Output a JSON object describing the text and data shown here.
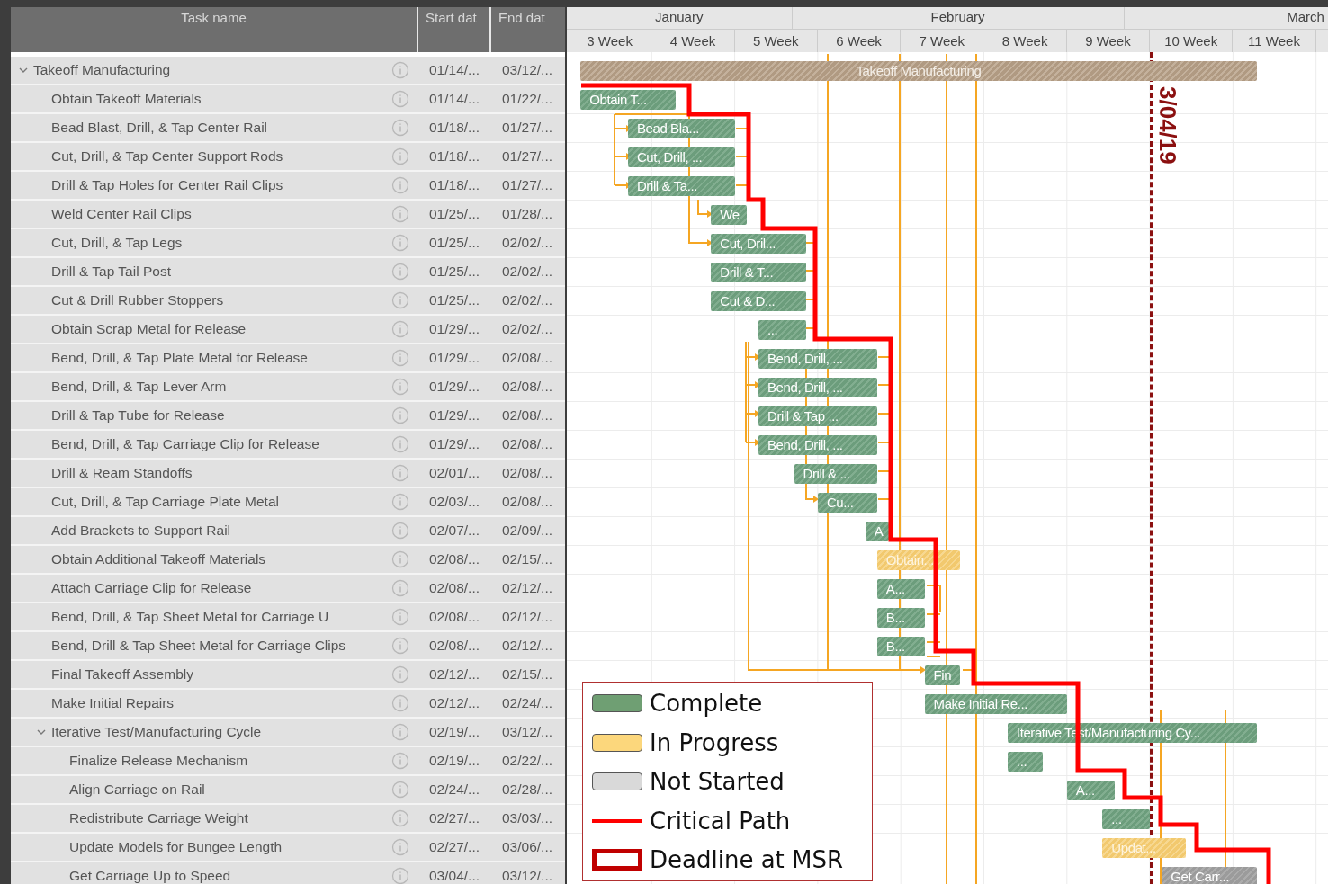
{
  "columns": [
    "Task name",
    "Start dat",
    "End dat"
  ],
  "timeline": {
    "months": [
      "January",
      "February",
      "March"
    ],
    "weeks": [
      "3 Week",
      "4 Week",
      "5 Week",
      "6 Week",
      "7 Week",
      "8 Week",
      "9 Week",
      "10 Week",
      "11 Week"
    ]
  },
  "tasks": [
    {
      "name": "Takeoff Manufacturing",
      "start": "01/14/...",
      "end": "03/12/...",
      "kind": "summary",
      "bar_label": "Takeoff Manufacturing",
      "expanded": true,
      "children": [
        {
          "name": "Obtain Takeoff Materials",
          "start": "01/14/...",
          "end": "01/22/...",
          "kind": "complete",
          "bar_label": "Obtain T..."
        },
        {
          "name": "Bead Blast, Drill, & Tap Center Rail",
          "start": "01/18/...",
          "end": "01/27/...",
          "kind": "complete",
          "bar_label": "Bead Bla..."
        },
        {
          "name": "Cut, Drill, & Tap Center Support Rods",
          "start": "01/18/...",
          "end": "01/27/...",
          "kind": "complete",
          "bar_label": "Cut, Drill, ..."
        },
        {
          "name": "Drill & Tap Holes for Center Rail Clips",
          "start": "01/18/...",
          "end": "01/27/...",
          "kind": "complete",
          "bar_label": "Drill & Ta..."
        },
        {
          "name": "Weld Center Rail Clips",
          "start": "01/25/...",
          "end": "01/28/...",
          "kind": "complete",
          "bar_label": "We"
        },
        {
          "name": "Cut, Drill, & Tap Legs",
          "start": "01/25/...",
          "end": "02/02/...",
          "kind": "complete",
          "bar_label": "Cut, Dril..."
        },
        {
          "name": "Drill & Tap Tail Post",
          "start": "01/25/...",
          "end": "02/02/...",
          "kind": "complete",
          "bar_label": "Drill & T..."
        },
        {
          "name": "Cut & Drill Rubber Stoppers",
          "start": "01/25/...",
          "end": "02/02/...",
          "kind": "complete",
          "bar_label": "Cut & D..."
        },
        {
          "name": "Obtain Scrap Metal for Release",
          "start": "01/29/...",
          "end": "02/02/...",
          "kind": "complete",
          "bar_label": "..."
        },
        {
          "name": "Bend, Drill, & Tap Plate Metal for Release",
          "start": "01/29/...",
          "end": "02/08/...",
          "kind": "complete",
          "bar_label": "Bend, Drill, ..."
        },
        {
          "name": "Bend, Drill, & Tap Lever Arm",
          "start": "01/29/...",
          "end": "02/08/...",
          "kind": "complete",
          "bar_label": "Bend, Drill, ..."
        },
        {
          "name": "Drill & Tap Tube for Release",
          "start": "01/29/...",
          "end": "02/08/...",
          "kind": "complete",
          "bar_label": "Drill & Tap ..."
        },
        {
          "name": "Bend, Drill, & Tap Carriage Clip for Release",
          "start": "01/29/...",
          "end": "02/08/...",
          "kind": "complete",
          "bar_label": "Bend, Drill, ..."
        },
        {
          "name": "Drill & Ream Standoffs",
          "start": "02/01/...",
          "end": "02/08/...",
          "kind": "complete",
          "bar_label": "Drill & ..."
        },
        {
          "name": "Cut, Drill, & Tap Carriage Plate Metal",
          "start": "02/03/...",
          "end": "02/08/...",
          "kind": "complete",
          "bar_label": "Cu..."
        },
        {
          "name": "Add Brackets to Support Rail",
          "start": "02/07/...",
          "end": "02/09/...",
          "kind": "complete",
          "bar_label": "A"
        },
        {
          "name": "Obtain Additional Takeoff Materials",
          "start": "02/08/...",
          "end": "02/15/...",
          "kind": "in_progress",
          "bar_label": "Obtain..."
        },
        {
          "name": "Attach Carriage Clip for Release",
          "start": "02/08/...",
          "end": "02/12/...",
          "kind": "complete",
          "bar_label": "A..."
        },
        {
          "name": "Bend, Drill, & Tap Sheet Metal for Carriage U",
          "start": "02/08/...",
          "end": "02/12/...",
          "kind": "complete",
          "bar_label": "B..."
        },
        {
          "name": "Bend, Drill & Tap Sheet Metal for Carriage Clips",
          "start": "02/08/...",
          "end": "02/12/...",
          "kind": "complete",
          "bar_label": "B..."
        },
        {
          "name": "Final Takeoff Assembly",
          "start": "02/12/...",
          "end": "02/15/...",
          "kind": "complete",
          "bar_label": "Fin"
        },
        {
          "name": "Make Initial Repairs",
          "start": "02/12/...",
          "end": "02/24/...",
          "kind": "complete",
          "bar_label": "Make Initial Re..."
        },
        {
          "name": "Iterative Test/Manufacturing Cycle",
          "start": "02/19/...",
          "end": "03/12/...",
          "kind": "complete",
          "bar_label": "Iterative Test/Manufacturing Cy...",
          "expanded": true,
          "children": [
            {
              "name": "Finalize Release Mechanism",
              "start": "02/19/...",
              "end": "02/22/...",
              "kind": "complete",
              "bar_label": "..."
            },
            {
              "name": "Align Carriage on Rail",
              "start": "02/24/...",
              "end": "02/28/...",
              "kind": "complete",
              "bar_label": "A..."
            },
            {
              "name": "Redistribute Carriage Weight",
              "start": "02/27/...",
              "end": "03/03/...",
              "kind": "complete",
              "bar_label": "..."
            },
            {
              "name": "Update Models for Bungee Length",
              "start": "02/27/...",
              "end": "03/06/...",
              "kind": "in_progress",
              "bar_label": "Updat..."
            },
            {
              "name": "Get Carriage Up to Speed",
              "start": "03/04/...",
              "end": "03/12/...",
              "kind": "not_started",
              "bar_label": "Get Carr..."
            }
          ]
        }
      ]
    }
  ],
  "deadline": {
    "label": "3/04/19"
  },
  "legend": [
    {
      "kind": "complete",
      "label": "Complete"
    },
    {
      "kind": "in_progress",
      "label": "In Progress"
    },
    {
      "kind": "not_started",
      "label": "Not Started"
    },
    {
      "kind": "critical_path",
      "label": "Critical Path"
    },
    {
      "kind": "deadline",
      "label": "Deadline at MSR"
    }
  ]
}
